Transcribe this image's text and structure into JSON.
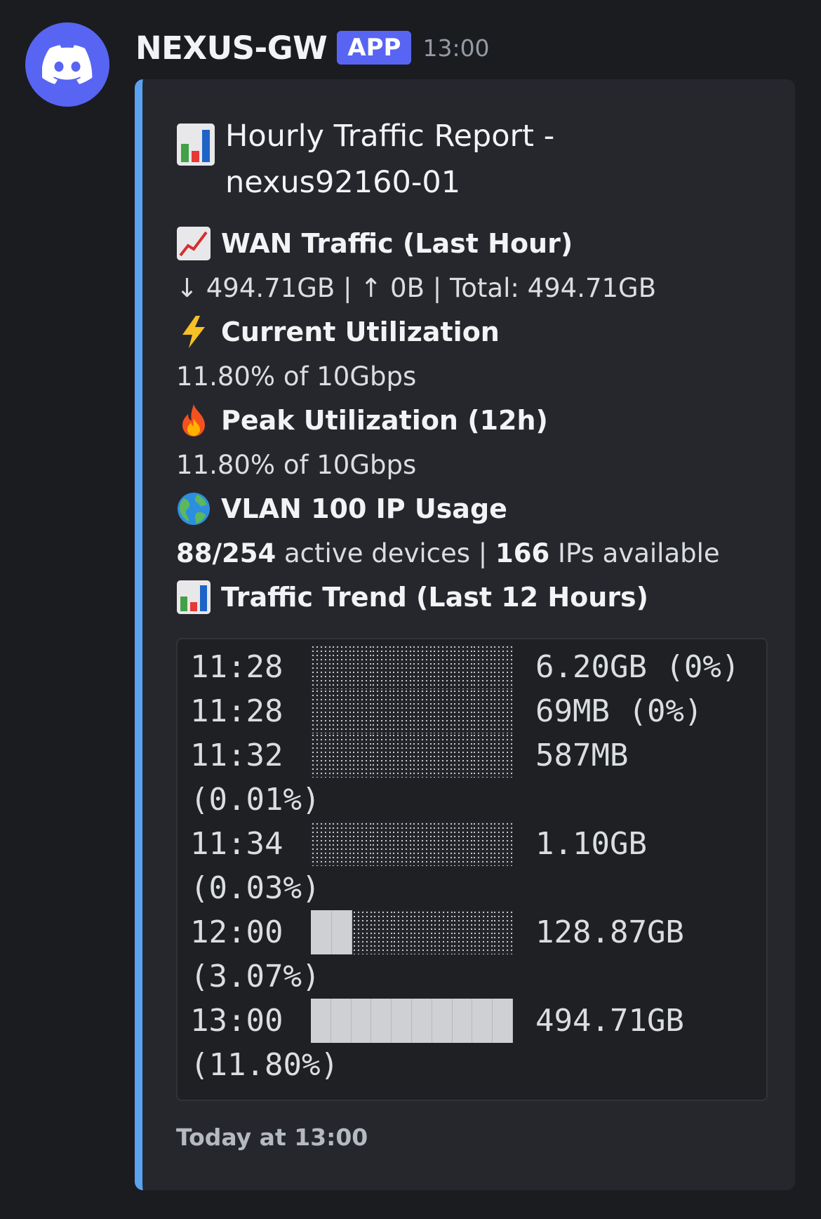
{
  "message": {
    "avatar_icon": "discord-logo-icon",
    "author": "NEXUS-GW",
    "badge": "APP",
    "time": "13:00"
  },
  "embed": {
    "accent_color": "#5aa3f0",
    "title": "Hourly Traffic Report - nexus92160-01",
    "title_icon": "bar-chart-emoji",
    "fields": [
      {
        "icon": "chart-increasing-emoji",
        "name": "WAN Traffic (Last Hour)",
        "value": "↓ 494.71GB | ↑ 0B | Total: 494.71GB"
      },
      {
        "icon": "high-voltage-emoji",
        "name": "Current Utilization",
        "value": "11.80% of 10Gbps"
      },
      {
        "icon": "fire-emoji",
        "name": "Peak Utilization (12h)",
        "value": "11.80% of 10Gbps"
      },
      {
        "icon": "globe-emoji",
        "name": "VLAN 100 IP Usage",
        "value_parts": {
          "active": "88/254",
          "active_suffix": " active devices | ",
          "available": "166",
          "available_suffix": " IPs available"
        }
      },
      {
        "icon": "bar-chart-emoji",
        "name": "Traffic Trend (Last 12 Hours)"
      }
    ],
    "trend": [
      {
        "time": "11:28",
        "label": "6.20GB (0%)",
        "percent": 0,
        "full_cells": 0,
        "wrap": ""
      },
      {
        "time": "11:28",
        "label": "69MB (0%)",
        "percent": 0,
        "full_cells": 0,
        "wrap": ""
      },
      {
        "time": "11:32",
        "label": "587MB",
        "percent": 0.01,
        "full_cells": 0,
        "wrap": "(0.01%)"
      },
      {
        "time": "11:34",
        "label": "1.10GB",
        "percent": 0.03,
        "full_cells": 0,
        "wrap": "(0.03%)"
      },
      {
        "time": "12:00",
        "label": "128.87GB",
        "percent": 3.07,
        "full_cells": 2,
        "wrap": "(3.07%)"
      },
      {
        "time": "13:00",
        "label": "494.71GB",
        "percent": 11.8,
        "full_cells": 10,
        "wrap": "(11.80%)"
      }
    ],
    "footer": "Today at 13:00"
  }
}
